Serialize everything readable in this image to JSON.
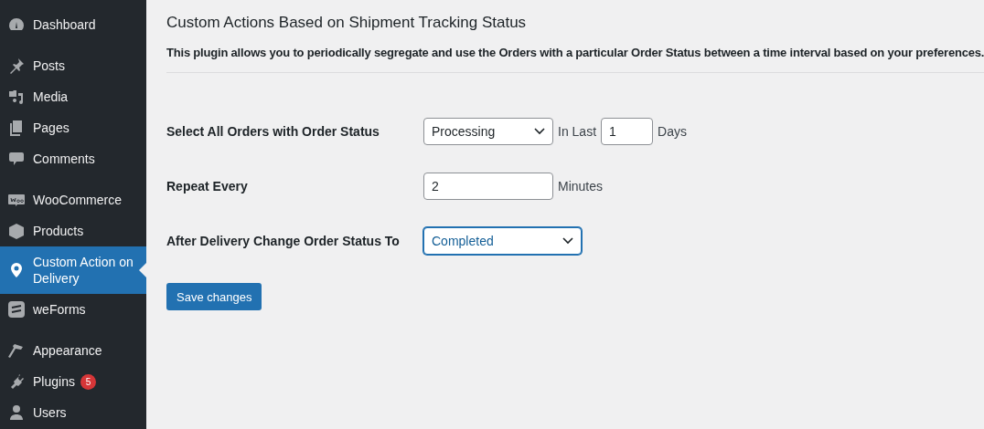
{
  "sidebar": {
    "groups": [
      [
        {
          "label": "Dashboard",
          "selected": false
        }
      ],
      [
        {
          "label": "Posts",
          "selected": false
        },
        {
          "label": "Media",
          "selected": false
        },
        {
          "label": "Pages",
          "selected": false
        },
        {
          "label": "Comments",
          "selected": false
        }
      ],
      [
        {
          "label": "WooCommerce",
          "selected": false
        },
        {
          "label": "Products",
          "selected": false
        },
        {
          "label": "Custom Action on Delivery",
          "selected": true
        },
        {
          "label": "weForms",
          "selected": false
        }
      ],
      [
        {
          "label": "Appearance",
          "selected": false
        },
        {
          "label": "Plugins",
          "selected": false,
          "badge": "5"
        },
        {
          "label": "Users",
          "selected": false
        }
      ]
    ]
  },
  "page": {
    "title": "Custom Actions Based on Shipment Tracking Status",
    "description": "This plugin allows you to periodically segregate and use the Orders with a particular Order Status between a time interval based on your preferences.",
    "rows": [
      {
        "label": "Select All Orders with Order Status",
        "controls": [
          {
            "kind": "select",
            "value": "Processing",
            "focused": false
          },
          {
            "kind": "text",
            "text": "In Last"
          },
          {
            "kind": "input",
            "value": "1",
            "wide": false
          },
          {
            "kind": "text",
            "text": "Days"
          }
        ]
      },
      {
        "label": "Repeat Every",
        "controls": [
          {
            "kind": "input",
            "value": "2",
            "wide": true
          },
          {
            "kind": "text",
            "text": "Minutes"
          }
        ]
      },
      {
        "label": "After Delivery Change Order Status To",
        "controls": [
          {
            "kind": "select",
            "value": "Completed",
            "focused": true
          }
        ]
      }
    ],
    "save_button": "Save changes"
  }
}
